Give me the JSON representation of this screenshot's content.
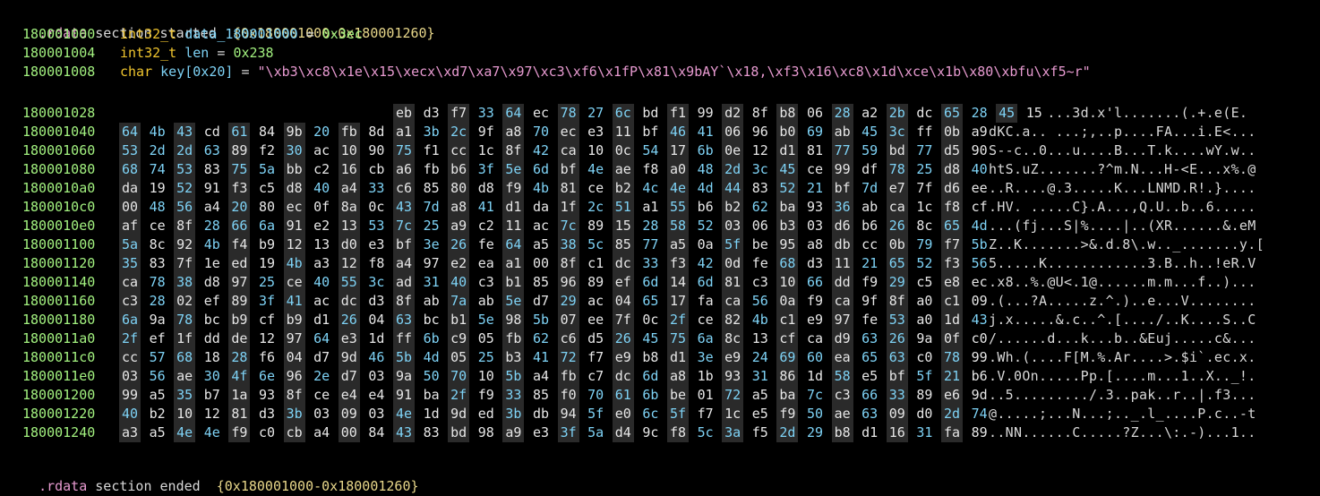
{
  "section_start": {
    "prefix": ".rdata",
    "mid": " section started  ",
    "range": "{0x180001000-0x180001260}"
  },
  "section_end": {
    "prefix": ".rdata",
    "mid": " section ended  ",
    "range": "{0x180001000-0x180001260}"
  },
  "decls": [
    {
      "addr": "180001000",
      "type": "int32_t",
      "name": "data_180001000",
      "op": " = ",
      "value": "0x3ec",
      "value_kind": "num"
    },
    {
      "addr": "180001004",
      "type": "int32_t",
      "name": "len",
      "op": " = ",
      "value": "0x238",
      "value_kind": "num"
    },
    {
      "addr": "180001008",
      "type": "char",
      "name": "key[0x20]",
      "op": " = ",
      "value": "\"\\xb3\\xc8\\x1e\\x15\\xecx\\xd7\\xa7\\x97\\xc3\\xf6\\x1fP\\x81\\x9bAY`\\x18,\\xf3\\x16\\xc8\\x1d\\xce\\x1b\\x80\\xbfu\\xf5~r\"",
      "value_kind": "str"
    }
  ],
  "hex_rows": [
    {
      "addr": "180001028",
      "offset": 10,
      "bytes": "eb d3 f7 33 64 ec 78 27 6c bd f1 99 d2 8f b8 06 28 a2 2b dc 65 28 45 15",
      "ascii": "       ...3d.x'l.......(.+.e(E."
    },
    {
      "addr": "180001040",
      "offset": 0,
      "bytes": "64 4b 43 cd 61 84 9b 20 fb 8d a1 3b 2c 9f a8 70 ec e3 11 bf 46 41 06 96 b0 69 ab 45 3c ff 0b a9",
      "ascii": "dKC.a.. ...;,..p....FA...i.E<..."
    },
    {
      "addr": "180001060",
      "offset": 0,
      "bytes": "53 2d 2d 63 89 f2 30 ac 10 90 75 f1 cc 1c 8f 42 ca 10 0c 54 17 6b 0e 12 d1 81 77 59 bd 77 d5 90",
      "ascii": "S--c..0...u....B...T.k....wY.w.."
    },
    {
      "addr": "180001080",
      "offset": 0,
      "bytes": "68 74 53 83 75 5a bb c2 16 cb a6 fb b6 3f 5e 6d bf 4e ae f8 a0 48 2d 3c 45 ce 99 df 78 25 d8 40",
      "ascii": "htS.uZ.......?^m.N...H-<E...x%.@"
    },
    {
      "addr": "1800010a0",
      "offset": 0,
      "bytes": "da 19 52 91 f3 c5 d8 40 a4 33 c6 85 80 d8 f9 4b 81 ce b2 4c 4e 4d 44 83 52 21 bf 7d e7 7f d6 ee",
      "ascii": "..R....@.3.....K...LNMD.R!.}...."
    },
    {
      "addr": "1800010c0",
      "offset": 0,
      "bytes": "00 48 56 a4 20 80 ec 0f 8a 0c 43 7d a8 41 d1 da 1f 2c 51 a1 55 b6 b2 62 ba 93 36 ab ca 1c f8 cf",
      "ascii": ".HV. .....C}.A...,Q.U..b..6....."
    },
    {
      "addr": "1800010e0",
      "offset": 0,
      "bytes": "af ce 8f 28 66 6a 91 e2 13 53 7c 25 a9 c2 11 ac 7c 89 15 28 58 52 03 06 b3 03 d6 b6 26 8c 65 4d",
      "ascii": "...(fj...S|%....|..(XR......&.eM"
    },
    {
      "addr": "180001100",
      "offset": 0,
      "bytes": "5a 8c 92 4b f4 b9 12 13 d0 e3 bf 3e 26 fe 64 a5 38 5c 85 77 a5 0a 5f be 95 a8 db cc 0b 79 f7 5b",
      "ascii": "Z..K.......>&.d.8\\.w.._.......y.["
    },
    {
      "addr": "180001120",
      "offset": 0,
      "bytes": "35 83 7f 1e ed 19 4b a3 12 f8 a4 97 e2 ea a1 00 8f c1 dc 33 f3 42 0d fe 68 d3 11 21 65 52 f3 56",
      "ascii": "5.....K............3.B..h..!eR.V"
    },
    {
      "addr": "180001140",
      "offset": 0,
      "bytes": "ca 78 38 d8 97 25 ce 40 55 3c ad 31 40 c3 b1 85 96 89 ef 6d 14 6d 81 c3 10 66 dd f9 29 c5 e8 ec",
      "ascii": ".x8..%.@U<.1@......m.m...f..)..."
    },
    {
      "addr": "180001160",
      "offset": 0,
      "bytes": "c3 28 02 ef 89 3f 41 ac dc d3 8f ab 7a ab 5e d7 29 ac 04 65 17 fa ca 56 0a f9 ca 9f 8f a0 c1 09",
      "ascii": ".(...?A.....z.^.)..e...V........"
    },
    {
      "addr": "180001180",
      "offset": 0,
      "bytes": "6a 9a 78 bc b9 cf b9 d1 26 04 63 bc b1 5e 98 5b 07 ee 7f 0c 2f ce 82 4b c1 e9 97 fe 53 a0 1d 43",
      "ascii": "j.x.....&.c..^.[..../..K....S..C"
    },
    {
      "addr": "1800011a0",
      "offset": 0,
      "bytes": "2f ef 1f dd de 12 97 64 e3 1d ff 6b c9 05 fb 62 c6 d5 26 45 75 6a 8c 13 cf ca d9 63 26 9a 0f c0",
      "ascii": "/......d...k...b..&Euj.....c&..."
    },
    {
      "addr": "1800011c0",
      "offset": 0,
      "bytes": "cc 57 68 18 28 f6 04 d7 9d 46 5b 4d 05 25 b3 41 72 f7 e9 b8 d1 3e e9 24 69 60 ea 65 63 c0 78 99",
      "ascii": ".Wh.(....F[M.%.Ar....>.$i`.ec.x."
    },
    {
      "addr": "1800011e0",
      "offset": 0,
      "bytes": "03 56 ae 30 4f 6e 96 2e d7 03 9a 50 70 10 5b a4 fb c7 dc 6d a8 1b 93 31 86 1d 58 e5 bf 5f 21 b6",
      "ascii": ".V.0On.....Pp.[....m...1..X.._!."
    },
    {
      "addr": "180001200",
      "offset": 0,
      "bytes": "99 a5 35 b7 1a 93 8f ce e4 e4 91 ba 2f f9 33 85 f0 70 61 6b be 01 72 a5 ba 7c c3 66 33 89 e6 9d",
      "ascii": "..5........./.3..pak..r..|.f3..."
    },
    {
      "addr": "180001220",
      "offset": 0,
      "bytes": "40 b2 10 12 81 d3 3b 03 09 03 4e 1d 9d ed 3b db 94 5f e0 6c 5f f7 1c e5 f9 50 ae 63 09 d0 2d 74",
      "ascii": "@.....;...N...;.._.l_....P.c..-t"
    },
    {
      "addr": "180001240",
      "offset": 0,
      "bytes": "a3 a5 4e 4e f9 c0 cb a4 00 84 43 83 bd 98 a9 e3 3f 5a d4 9c f8 5c 3a f5 2d 29 b8 d1 16 31 fa 89",
      "ascii": "..NN......C.....?Z...\\:.-)...1.."
    }
  ],
  "colors": {
    "background": "#000000",
    "address": "#a2f07f",
    "type": "#f0c52e",
    "identifier": "#7ed2f5",
    "string": "#e79ad0",
    "byte_bg": "#2a2a2a"
  }
}
